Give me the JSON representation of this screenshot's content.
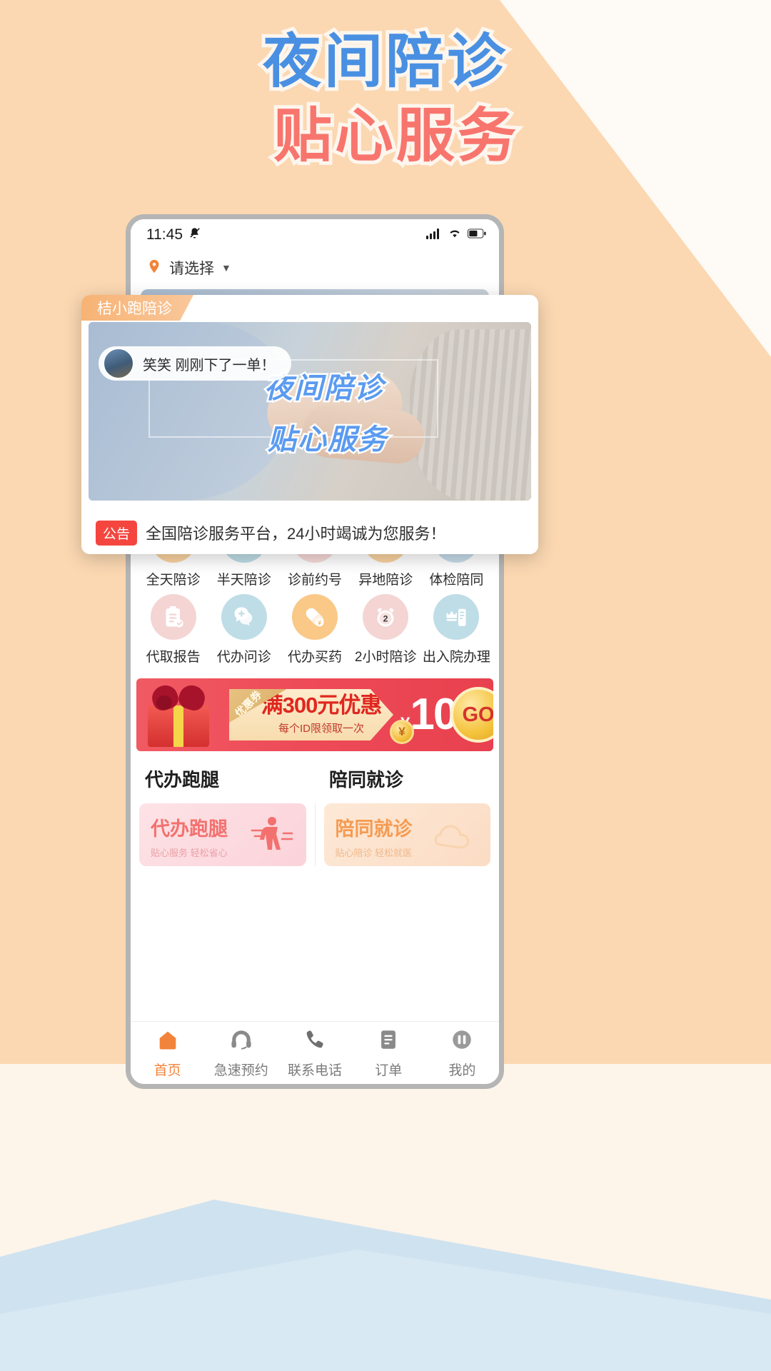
{
  "promo": {
    "headline_line1": "夜间陪诊",
    "headline_line2": "贴心服务",
    "headline_color_blue": "#4a90e2",
    "headline_color_red": "#f8756e",
    "background_color": "#fbd7b0"
  },
  "statusbar": {
    "time": "11:45",
    "mute_icon": "bell-mute-icon",
    "signal_icon": "signal-bars-icon",
    "wifi_icon": "wifi-icon",
    "battery_icon": "battery-icon"
  },
  "location": {
    "pin_icon": "location-pin-icon",
    "label": "请选择",
    "caret": "▼"
  },
  "popup": {
    "tab_label": "桔小跑陪诊",
    "toast": {
      "avatar": "user-avatar",
      "text": "笑笑 刚刚下了一单！"
    },
    "hero": {
      "line1": "夜间陪诊",
      "line2": "贴心服务"
    },
    "announcement": {
      "badge": "公告",
      "text": "全国陪诊服务平台，24小时竭诚为您服务！"
    }
  },
  "announcement": {
    "badge": "公告",
    "text": "全国陪诊服务平台，24小时竭诚为您服务！"
  },
  "services": [
    {
      "label": "全天陪诊",
      "icon": "parent-child-icon",
      "bg": "#fad3a0",
      "fg": "#ffffff"
    },
    {
      "label": "半天陪诊",
      "icon": "clock-refresh-icon",
      "bg": "#bfdde6",
      "fg": "#ffffff"
    },
    {
      "label": "诊前约号",
      "icon": "stethoscope-icon",
      "bg": "#f7dad8",
      "fg": "#ffffff"
    },
    {
      "label": "异地陪诊",
      "icon": "map-fold-icon",
      "bg": "#fad3a0",
      "fg": "#ffffff"
    },
    {
      "label": "体检陪同",
      "icon": "document-search-icon",
      "bg": "#c7dcea",
      "fg": "#ffffff"
    },
    {
      "label": "代取报告",
      "icon": "clipboard-check-icon",
      "bg": "#f4d5d3",
      "fg": "#ffffff"
    },
    {
      "label": "代办问诊",
      "icon": "chat-plus-icon",
      "bg": "#bfdde6",
      "fg": "#ffffff"
    },
    {
      "label": "代办买药",
      "icon": "pill-yuan-icon",
      "bg": "#fac887",
      "fg": "#ffffff"
    },
    {
      "label": "2小时陪诊",
      "icon": "alarm-clock-icon",
      "bg": "#f4d5d3",
      "fg": "#ffffff",
      "badge_number": "2"
    },
    {
      "label": "出入院办理",
      "icon": "crown-document-icon",
      "bg": "#bfdde6",
      "fg": "#ffffff"
    }
  ],
  "coupon": {
    "ribbon_label": "优惠券",
    "main_text": "满300元优惠",
    "sub_text": "每个ID限领取一次",
    "currency": "¥",
    "amount": "10",
    "go_label": "GO",
    "coin_symbol": "¥",
    "bg_color": "#ee4b58",
    "main_text_color": "#e0271f"
  },
  "sections": [
    {
      "title": "代办跑腿",
      "card_title": "代办跑腿",
      "card_sub": "贴心服务 轻松省心",
      "style": "pink"
    },
    {
      "title": "陪同就诊",
      "card_title": "陪同就诊",
      "card_sub": "贴心陪诊 轻松就医",
      "style": "orange"
    }
  ],
  "tabbar": {
    "items": [
      {
        "label": "首页",
        "icon": "home-icon",
        "active": true
      },
      {
        "label": "急速预约",
        "icon": "speed-booking-icon",
        "active": false
      },
      {
        "label": "联系电话",
        "icon": "phone-icon",
        "active": false
      },
      {
        "label": "订单",
        "icon": "order-icon",
        "active": false
      },
      {
        "label": "我的",
        "icon": "profile-icon",
        "active": false
      }
    ],
    "active_color": "#f2833a",
    "inactive_color": "#7a7a7a"
  }
}
